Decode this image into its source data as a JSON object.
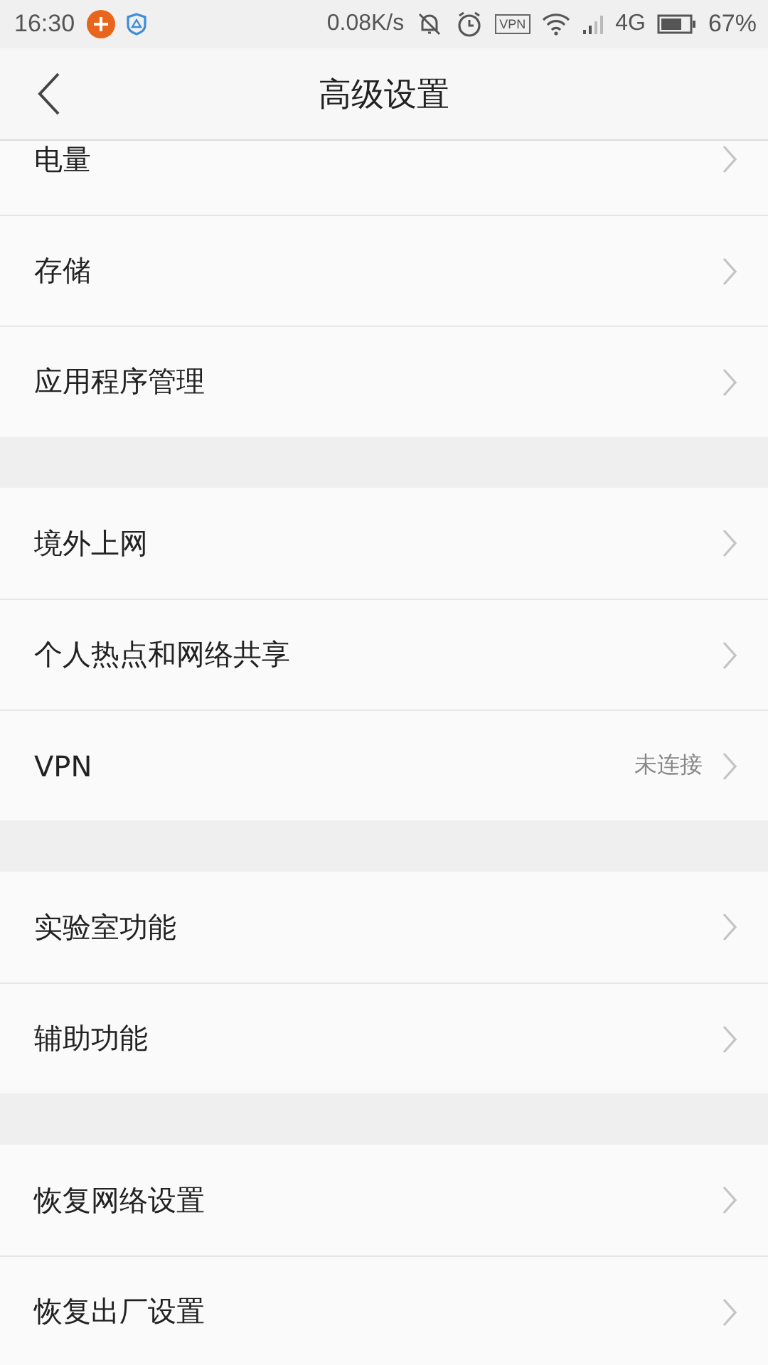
{
  "status_bar": {
    "time": "16:30",
    "speed": "0.08K/s",
    "vpn": "VPN",
    "network": "4G",
    "battery": "67%"
  },
  "header": {
    "title": "高级设置"
  },
  "groups": [
    {
      "items": [
        {
          "label": "电量"
        },
        {
          "label": "存储"
        },
        {
          "label": "应用程序管理"
        }
      ]
    },
    {
      "items": [
        {
          "label": "境外上网"
        },
        {
          "label": "个人热点和网络共享"
        },
        {
          "label": "VPN",
          "value": "未连接"
        }
      ]
    },
    {
      "items": [
        {
          "label": "实验室功能"
        },
        {
          "label": "辅助功能"
        }
      ]
    },
    {
      "items": [
        {
          "label": "恢复网络设置"
        },
        {
          "label": "恢复出厂设置"
        }
      ]
    }
  ]
}
